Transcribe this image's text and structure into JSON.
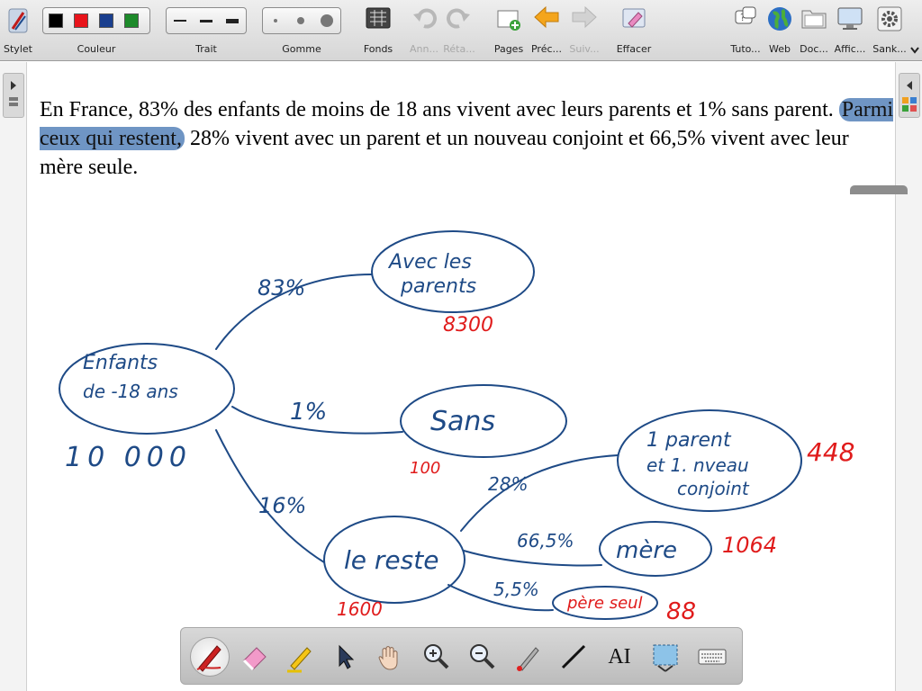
{
  "toolbar": {
    "stylet": "Stylet",
    "couleur": "Couleur",
    "trait": "Trait",
    "gomme": "Gomme",
    "fonds": "Fonds",
    "annuler": "Ann...",
    "retablir": "Réta...",
    "pages": "Pages",
    "precedent": "Préc...",
    "suivant": "Suiv...",
    "effacer": "Effacer",
    "tutoriel": "Tuto...",
    "web": "Web",
    "documents": "Doc...",
    "affichage": "Affic...",
    "sankore": "Sank...",
    "colors": [
      "#000000",
      "#e8141b",
      "#1a3f8f",
      "#1d8a2a"
    ]
  },
  "page": {
    "text_before": "En France, 83% des enfants de moins de 18 ans vivent avec leurs parents et 1% sans parent.",
    "text_highlight": "Parmi ceux qui restent,",
    "text_after": " 28% vivent avec un parent et un nouveau conjoint et 66,5% vivent avec leur mère seule."
  },
  "diagram": {
    "root_line1": "Enfants",
    "root_line2": "de  -18 ans",
    "root_count": "10 000",
    "node_parents_line1": "Avec les",
    "node_parents_line2": "parents",
    "node_sans": "Sans",
    "node_reste": "le reste",
    "node_conjoint_line1": "1 parent",
    "node_conjoint_line2": "et 1. nveau",
    "node_conjoint_line3": "conjoint",
    "node_mere": "mère",
    "node_pere": "père seul",
    "pct_parents": "83%",
    "pct_sans": "1%",
    "pct_reste": "16%",
    "pct_conjoint": "28%",
    "pct_mere": "66,5%",
    "pct_pere": "5,5%",
    "val_parents": "8300",
    "val_sans": "100",
    "val_reste": "1600",
    "val_conjoint": "448",
    "val_mere": "1064",
    "val_pere": "88"
  },
  "icons": {
    "pen": "pen-icon",
    "eraser": "eraser-icon",
    "marker": "marker-icon",
    "pointer": "pointer-icon",
    "hand": "hand-icon",
    "zoom_in": "zoom-in-icon",
    "zoom_out": "zoom-out-icon",
    "laser": "laser-icon",
    "line": "line-icon",
    "text": "text-icon",
    "capture": "capture-icon",
    "keyboard": "keyboard-icon"
  },
  "bottom_bar": {
    "text_tool_glyph": "AI"
  }
}
